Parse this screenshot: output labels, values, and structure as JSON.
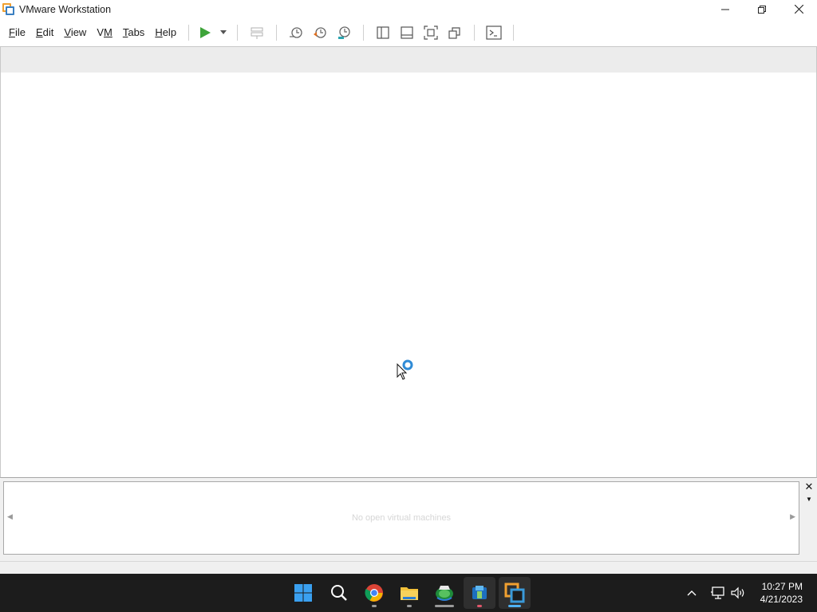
{
  "window": {
    "title": "VMware Workstation",
    "controls": [
      "minimize-icon",
      "restore-icon",
      "close-icon"
    ]
  },
  "menu": {
    "items": [
      {
        "label": "File",
        "accel": "F",
        "rest": "ile"
      },
      {
        "label": "Edit",
        "accel": "E",
        "rest": "dit"
      },
      {
        "label": "View",
        "accel": "V",
        "rest": "iew"
      },
      {
        "label": "VM",
        "accel": "V",
        "rest": "M"
      },
      {
        "label": "Tabs",
        "accel": "T",
        "rest": "abs"
      },
      {
        "label": "Help",
        "accel": "H",
        "rest": "elp"
      }
    ]
  },
  "toolbar": {
    "icons": [
      "power-on-icon",
      "power-dropdown-icon",
      "send-ctrl-alt-del-icon",
      "snapshot-icon",
      "revert-snapshot-icon",
      "snapshot-manager-icon",
      "library-view-icon",
      "thumbnail-bar-icon",
      "full-screen-icon",
      "unity-icon",
      "console-view-icon"
    ],
    "accent_play": "#3ea43a"
  },
  "thumbnail_bar": {
    "empty_text": "No open virtual machines"
  },
  "taskbar": {
    "apps": [
      "start-icon",
      "search-icon",
      "chrome-icon",
      "file-explorer-icon",
      "app-icon",
      "app-icon-2",
      "vmware-icon"
    ],
    "clock_time": "10:27 PM",
    "clock_date": "4/21/2023",
    "tray_icons": [
      "show-hidden-icons-icon",
      "network-icon",
      "volume-icon"
    ]
  },
  "colors": {
    "vmware_orange": "#f0a030",
    "vmware_blue": "#3a7fc1",
    "busy_blue": "#2f8bd6"
  }
}
